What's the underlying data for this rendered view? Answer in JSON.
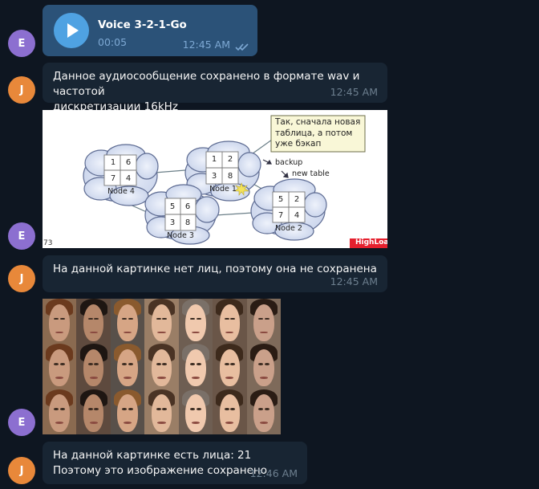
{
  "voice": {
    "title": "Voice 3-2-1-Go",
    "duration": "00:05",
    "time": "12:45 AM"
  },
  "avatars": {
    "e": "E",
    "j": "J"
  },
  "msg1": {
    "text": "Данное аудиосообщение сохранено в формате wav и частотой\nдискретизации 16kHz",
    "time": "12:45 AM"
  },
  "diagram": {
    "note": "Так, сначала новая\nтаблица, а потом\nуже бэкап",
    "label_backup": "backup",
    "label_new_table": "new table",
    "page_number": "73",
    "logo": "HighLoad",
    "nodes": [
      {
        "name": "Node 4",
        "cells": [
          "1",
          "6",
          "7",
          "4"
        ]
      },
      {
        "name": "Node 1",
        "cells": [
          "1",
          "2",
          "3",
          "8"
        ]
      },
      {
        "name": "Node 3",
        "cells": [
          "5",
          "6",
          "3",
          "8"
        ]
      },
      {
        "name": "Node 2",
        "cells": [
          "5",
          "2",
          "7",
          "4"
        ]
      }
    ]
  },
  "msg2": {
    "text": "На данной картинке нет лиц, поэтому она не сохранена",
    "time": "12:45 AM"
  },
  "msg3": {
    "text": "На данной картинке есть лица: 21\nПоэтому это изображение сохранено",
    "time": "12:46 AM"
  },
  "colors": {
    "background": "#0e1621",
    "incoming": "#182533",
    "outgoing": "#2b5278",
    "accent": "#4fa2e2"
  }
}
